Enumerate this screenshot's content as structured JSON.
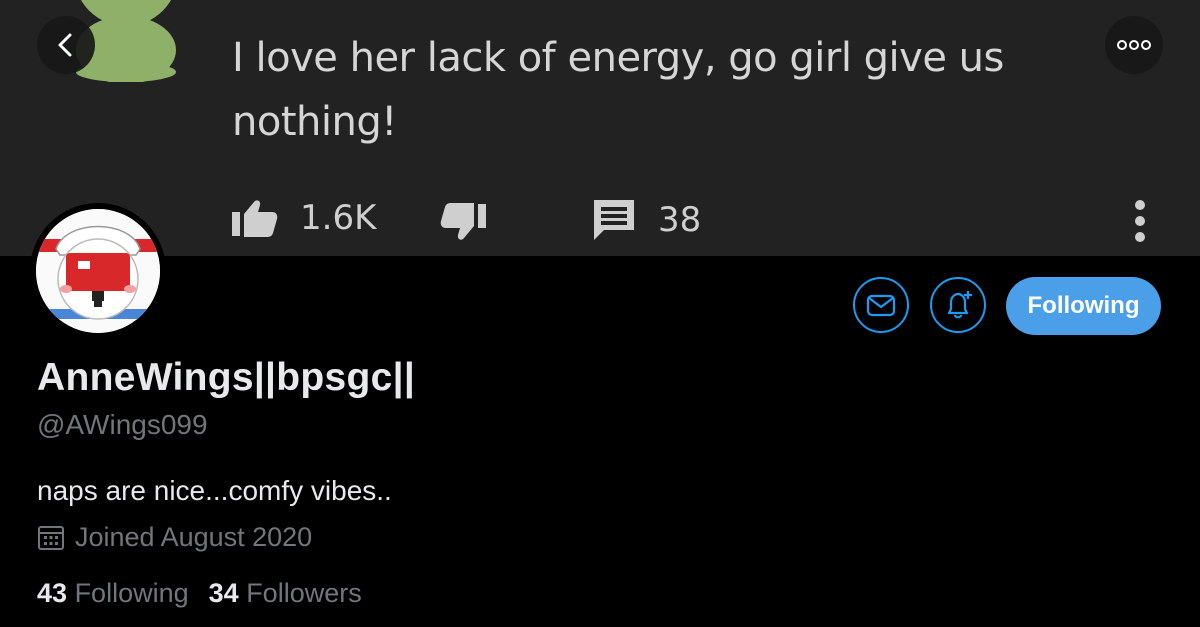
{
  "comment": {
    "text": "I love her lack of energy, go girl give us nothing!",
    "likes": "1.6K",
    "replies": "38"
  },
  "profile": {
    "display_name": "AnneWings||bpsgc||",
    "handle": "@AWings099",
    "bio": "naps are nice...comfy vibes..",
    "joined": "Joined August 2020",
    "following_count": "43",
    "following_label": "Following",
    "followers_count": "34",
    "followers_label": "Followers",
    "follow_button_label": "Following"
  },
  "icons": {
    "back": "chevron-left-icon",
    "more": "more-horizontal-icon",
    "message": "mail-icon",
    "notify": "bell-plus-icon",
    "calendar": "calendar-icon",
    "like": "thumbs-up-icon",
    "dislike": "thumbs-down-icon",
    "reply": "comment-icon",
    "kebab": "more-vertical-icon"
  },
  "colors": {
    "accent": "#1d9bf0",
    "follow_button": "#4a9fe8",
    "banner_bg": "#222222",
    "muted_text": "#71767b",
    "avatar_red": "#d9282a"
  }
}
